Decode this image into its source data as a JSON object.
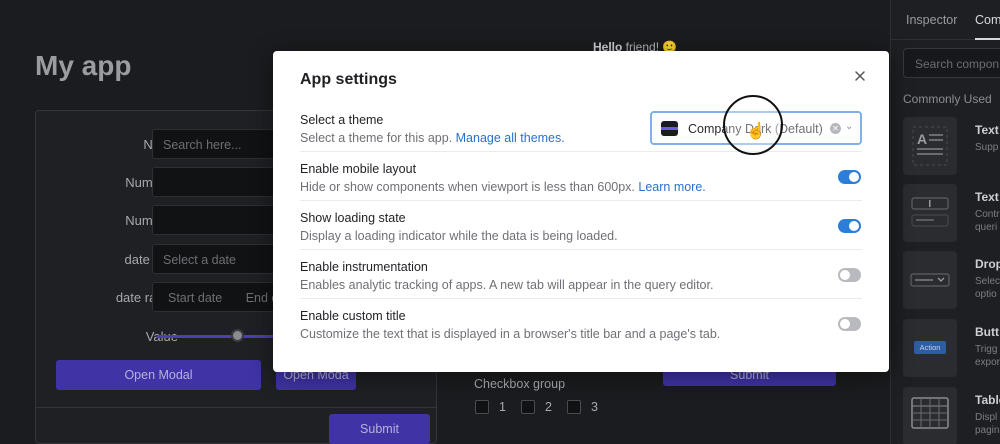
{
  "app": {
    "title": "My app",
    "greeting_bold": "Hello",
    "greeting_rest": " friend! 🙂",
    "form": {
      "name_label": "Name",
      "name_placeholder": "Search here...",
      "numbers1_label": "Numbers",
      "numbers2_label": "Numbers",
      "datetime_label": "date time",
      "datetime_placeholder": "Select a date",
      "daterange_label": "date range",
      "daterange_start": "Start date",
      "daterange_end": "End d",
      "value_label": "Value",
      "open_modal_label": "Open Modal",
      "open_modal_2_label": "Open Moda",
      "submit_label": "Submit"
    },
    "checkbox_group": {
      "title": "Checkbox group",
      "options": [
        "1",
        "2",
        "3"
      ]
    },
    "right_submit_label": "Submit"
  },
  "side_panel": {
    "tabs": [
      "Inspector",
      "Com"
    ],
    "active_tab": "Com",
    "search_placeholder": "Search compon",
    "section_title": "Commonly Used",
    "components": [
      {
        "name": "Text",
        "desc": "Supp",
        "icon": "text-icon"
      },
      {
        "name": "Text",
        "desc": "Contr\nqueri",
        "icon": "text-input-icon"
      },
      {
        "name": "Drop",
        "desc": "Selec\noptio",
        "icon": "dropdown-icon"
      },
      {
        "name": "Butt",
        "desc": "Trigg\nexpor",
        "icon": "button-icon",
        "tile_label": "Action"
      },
      {
        "name": "Table",
        "desc": "Displ\npagin",
        "icon": "table-icon"
      }
    ]
  },
  "modal": {
    "title": "App settings",
    "close_icon": "close-icon",
    "settings": [
      {
        "title": "Select a theme",
        "desc": "Select a theme for this app. ",
        "link": "Manage all themes.",
        "control": "select",
        "selected_name": "Company Dark",
        "selected_suffix": " (Default)"
      },
      {
        "title": "Enable mobile layout",
        "desc": "Hide or show components when viewport is less than 600px. ",
        "link": "Learn more.",
        "control": "toggle",
        "on": true
      },
      {
        "title": "Show loading state",
        "desc": "Display a loading indicator while the data is being loaded.",
        "link": "",
        "control": "toggle",
        "on": true
      },
      {
        "title": "Enable instrumentation",
        "desc": "Enables analytic tracking of apps. A new tab will appear in the query editor.",
        "link": "",
        "control": "toggle",
        "on": false
      },
      {
        "title": "Enable custom title",
        "desc": "Customize the text that is displayed in a browser's title bar and a page's tab.",
        "link": "",
        "control": "toggle",
        "on": false
      }
    ]
  },
  "colors": {
    "accent": "#2d7ed8",
    "link": "#2d6fcc",
    "bg_button": "#3f33a6"
  }
}
